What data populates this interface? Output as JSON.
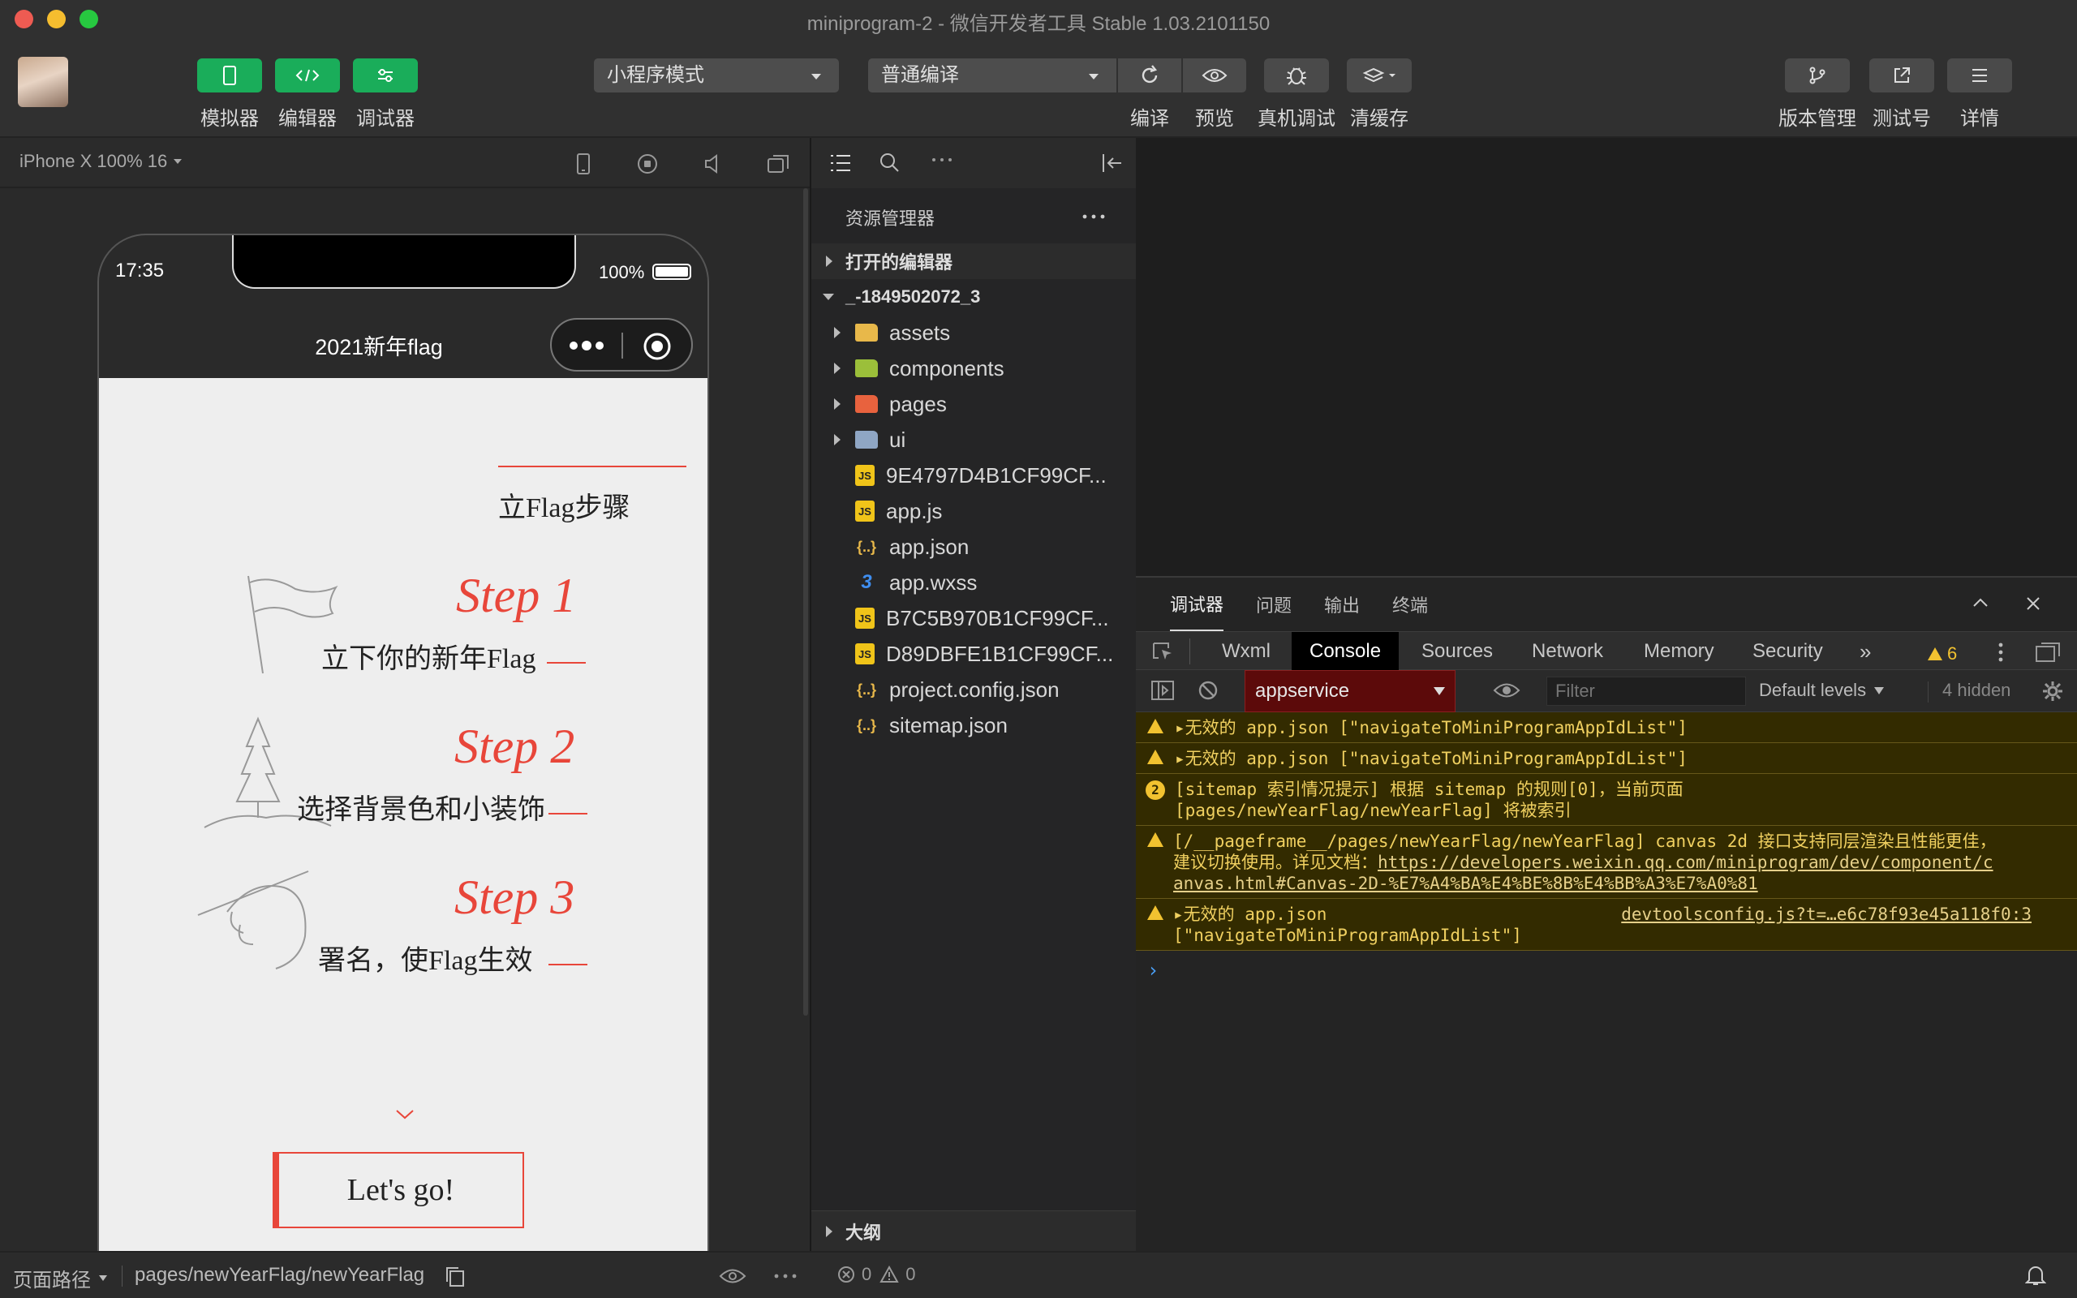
{
  "window": {
    "title": "miniprogram-2 - 微信开发者工具 Stable 1.03.2101150"
  },
  "toolbar": {
    "simulator": "模拟器",
    "editor": "编辑器",
    "debugger": "调试器",
    "mode_select": "小程序模式",
    "compile_select": "普通编译",
    "compile": "编译",
    "preview": "预览",
    "remote_debug": "真机调试",
    "clear_cache": "清缓存",
    "version": "版本管理",
    "test_account": "测试号",
    "details": "详情"
  },
  "simulator": {
    "device": "iPhone X 100% 16",
    "time": "17:35",
    "battery": "100%",
    "nav_title": "2021新年flag",
    "heading": "立Flag步骤",
    "steps": [
      {
        "title": "Step 1",
        "desc": "立下你的新年Flag"
      },
      {
        "title": "Step 2",
        "desc": "选择背景色和小装饰"
      },
      {
        "title": "Step 3",
        "desc": "署名，使Flag生效"
      }
    ],
    "cta": "Let's go!"
  },
  "explorer": {
    "title": "资源管理器",
    "open_editors": "打开的编辑器",
    "project": "_-1849502072_3",
    "files": [
      {
        "name": "assets",
        "type": "folder",
        "color": "#e8b84a"
      },
      {
        "name": "components",
        "type": "folder",
        "color": "#9bbf3a"
      },
      {
        "name": "pages",
        "type": "folder",
        "color": "#e8623e"
      },
      {
        "name": "ui",
        "type": "folder",
        "color": "#8fa6c4"
      },
      {
        "name": "9E4797D4B1CF99CF...",
        "type": "js"
      },
      {
        "name": "app.js",
        "type": "js"
      },
      {
        "name": "app.json",
        "type": "json"
      },
      {
        "name": "app.wxss",
        "type": "css"
      },
      {
        "name": "B7C5B970B1CF99CF...",
        "type": "js"
      },
      {
        "name": "D89DBFE1B1CF99CF...",
        "type": "js"
      },
      {
        "name": "project.config.json",
        "type": "json"
      },
      {
        "name": "sitemap.json",
        "type": "json"
      }
    ],
    "outline": "大纲"
  },
  "devtools": {
    "top_tabs": [
      "调试器",
      "问题",
      "输出",
      "终端"
    ],
    "panels": [
      "Wxml",
      "Console",
      "Sources",
      "Network",
      "Memory",
      "Security"
    ],
    "warning_count": "6",
    "context": "appservice",
    "filter_placeholder": "Filter",
    "levels": "Default levels",
    "hidden": "4 hidden",
    "messages": [
      {
        "kind": "warn",
        "lines": [
          "▸无效的 app.json [\"navigateToMiniProgramAppIdList\"]"
        ]
      },
      {
        "kind": "warn",
        "lines": [
          "▸无效的 app.json [\"navigateToMiniProgramAppIdList\"]"
        ]
      },
      {
        "kind": "count",
        "count": "2",
        "lines": [
          "[sitemap 索引情况提示] 根据 sitemap 的规则[0]，当前页面",
          "[pages/newYearFlag/newYearFlag] 将被索引"
        ]
      },
      {
        "kind": "warn",
        "lines": [
          "[/__pageframe__/pages/newYearFlag/newYearFlag] canvas 2d 接口支持同层渲染且性能更佳，",
          "建议切换使用。详见文档："
        ],
        "link": "https://developers.weixin.qq.com/miniprogram/dev/component/c",
        "link2": "anvas.html#Canvas-2D-%E7%A4%BA%E4%BE%8B%E4%BB%A3%E7%A0%81"
      },
      {
        "kind": "warn",
        "lines": [
          "▸无效的 app.json",
          "[\"navigateToMiniProgramAppIdList\"]"
        ],
        "source": "devtoolsconfig.js?t=…e6c78f93e45a118f0:3"
      }
    ]
  },
  "status": {
    "page_path_label": "页面路径",
    "page_path": "pages/newYearFlag/newYearFlag",
    "errors": "0",
    "warnings": "0"
  }
}
